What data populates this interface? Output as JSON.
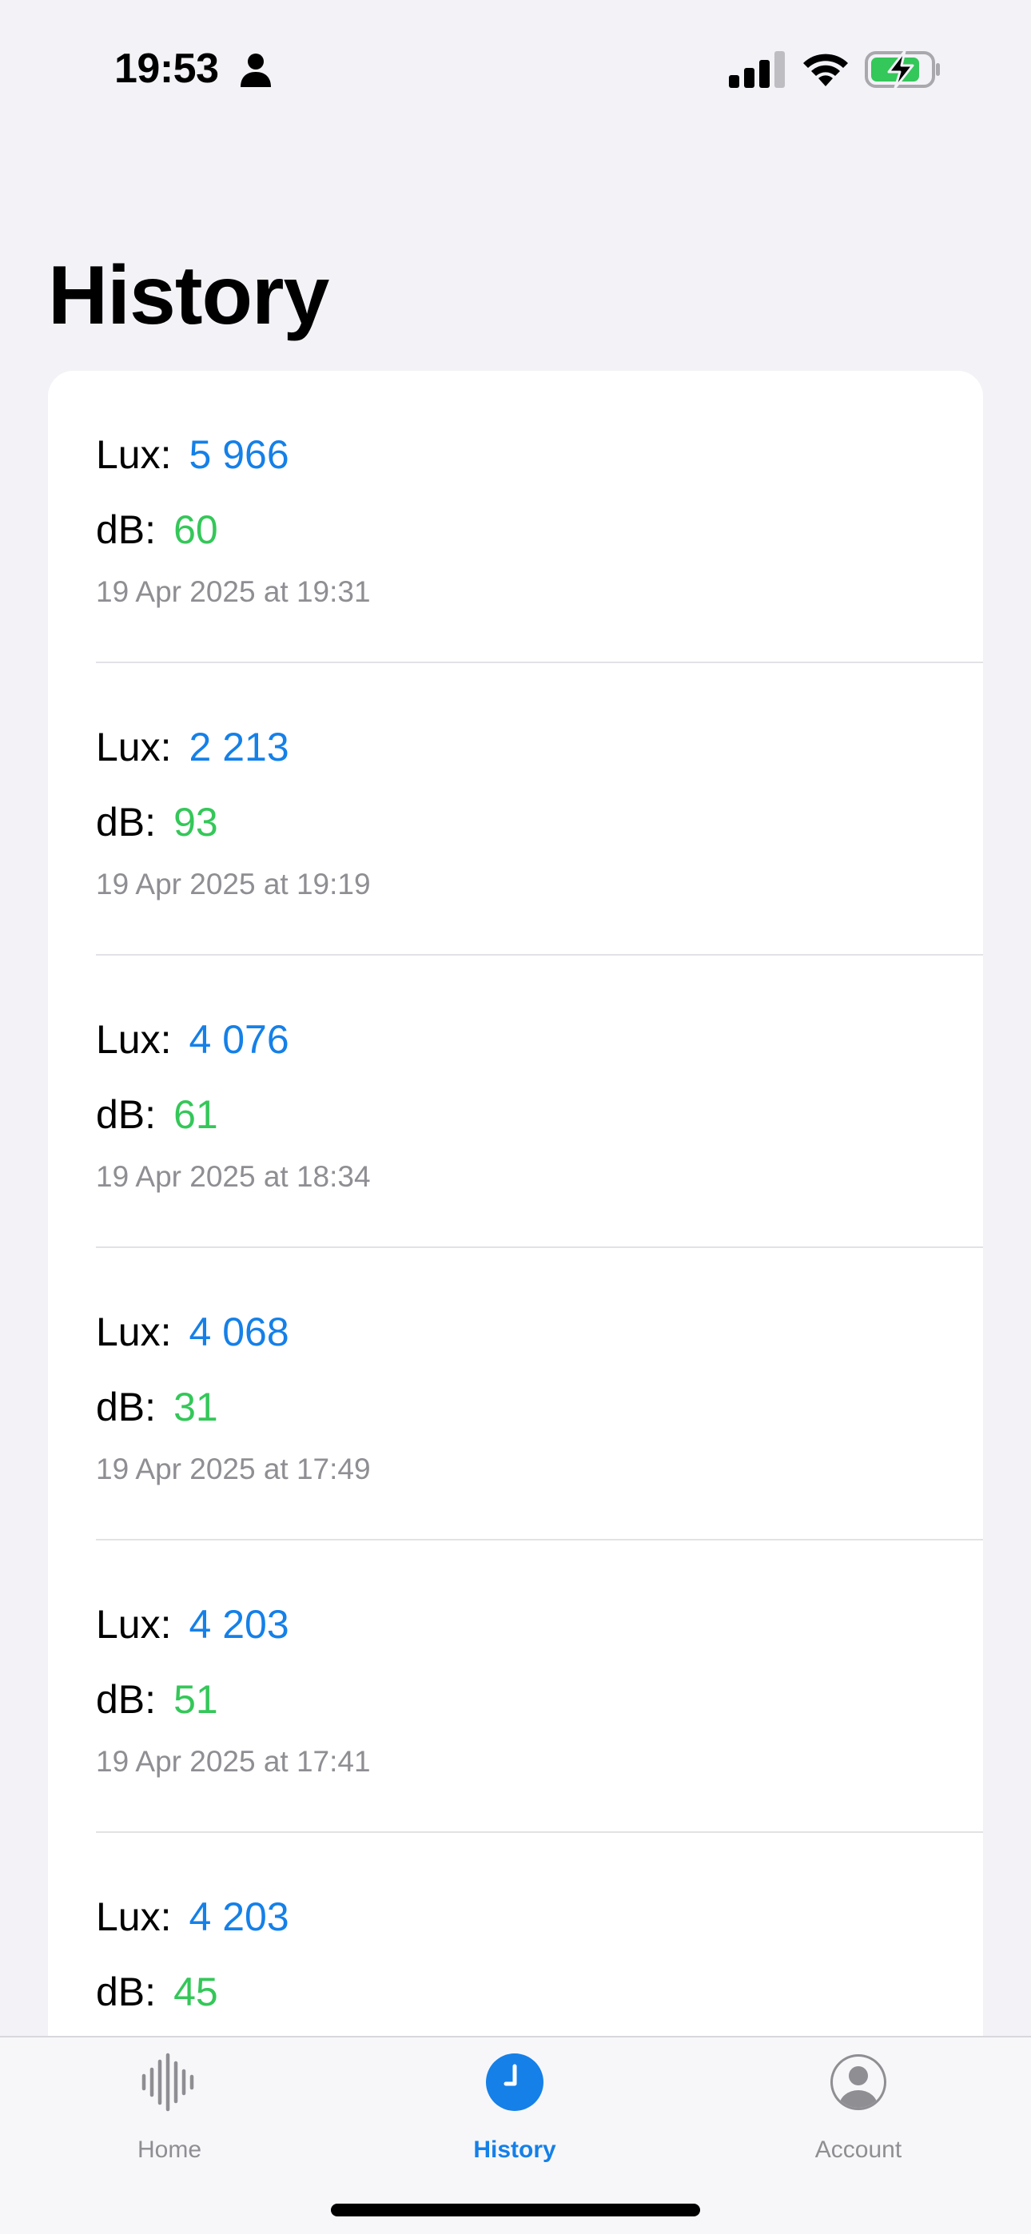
{
  "status_bar": {
    "time": "19:53",
    "icons": [
      "person-icon",
      "cellular-signal-icon",
      "wifi-icon",
      "battery-charging-icon"
    ]
  },
  "page": {
    "title": "History"
  },
  "colors": {
    "lux_value": "#1580E8",
    "db_value": "#34C759",
    "secondary_text": "#8E8E93",
    "accent": "#1580E8",
    "background": "#F2F2F7"
  },
  "history": {
    "lux_label": "Lux:",
    "db_label": "dB:",
    "entries": [
      {
        "lux": "5 966",
        "db": "60",
        "date": "19 Apr 2025 at 19:31"
      },
      {
        "lux": "2 213",
        "db": "93",
        "date": "19 Apr 2025 at 19:19"
      },
      {
        "lux": "4 076",
        "db": "61",
        "date": "19 Apr 2025 at 18:34"
      },
      {
        "lux": "4 068",
        "db": "31",
        "date": "19 Apr 2025 at 17:49"
      },
      {
        "lux": "4 203",
        "db": "51",
        "date": "19 Apr 2025 at 17:41"
      },
      {
        "lux": "4 203",
        "db": "45",
        "date": ""
      }
    ]
  },
  "tab_bar": {
    "items": [
      {
        "label": "Home",
        "icon": "waveform-icon",
        "active": false
      },
      {
        "label": "History",
        "icon": "clock-icon",
        "active": true
      },
      {
        "label": "Account",
        "icon": "person-circle-icon",
        "active": false
      }
    ]
  }
}
